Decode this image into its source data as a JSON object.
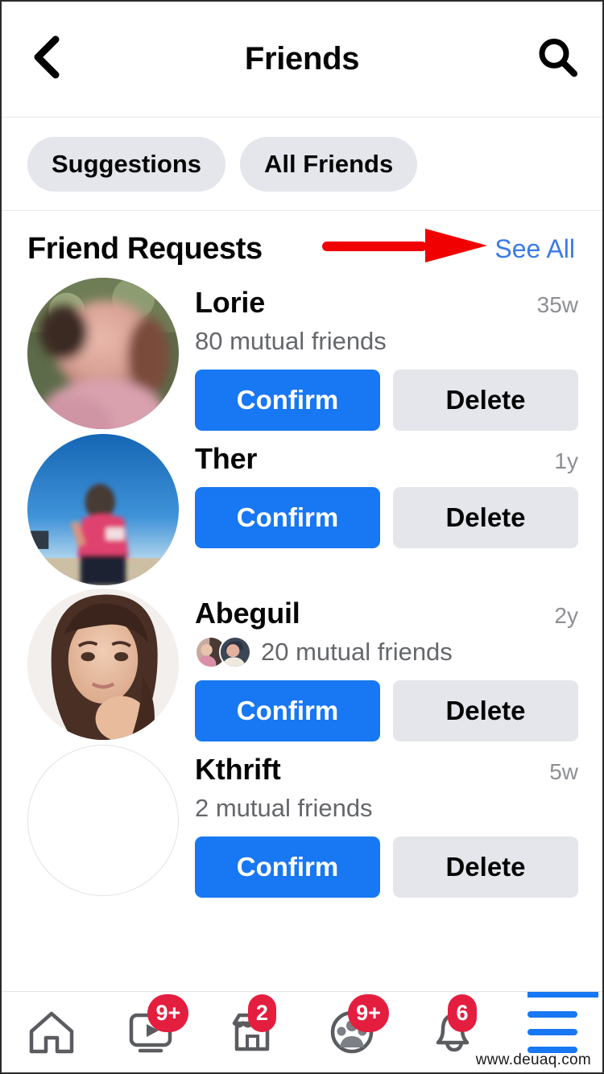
{
  "header": {
    "back_icon": "chevron-left-icon",
    "title": "Friends",
    "search_icon": "search-icon"
  },
  "chips": [
    {
      "label": "Suggestions"
    },
    {
      "label": "All Friends"
    }
  ],
  "section": {
    "title": "Friend Requests",
    "see_all_label": "See All",
    "annotation": {
      "type": "arrow",
      "color": "#f00000",
      "points_to": "See All"
    }
  },
  "requests": [
    {
      "name": "Lorie",
      "time": "35w",
      "mutual": "80 mutual friends",
      "mutual_faces": 0,
      "avatar": "blurred-photo-pink",
      "confirm_label": "Confirm",
      "delete_label": "Delete"
    },
    {
      "name": "Ther",
      "time": "1y",
      "mutual": "",
      "mutual_faces": 0,
      "avatar": "blurred-photo-beach",
      "confirm_label": "Confirm",
      "delete_label": "Delete"
    },
    {
      "name": "Abeguil",
      "time": "2y",
      "mutual": "20 mutual friends",
      "mutual_faces": 2,
      "avatar": "portrait-photo",
      "confirm_label": "Confirm",
      "delete_label": "Delete"
    },
    {
      "name": "Kthrift",
      "time": "5w",
      "mutual": "2 mutual friends",
      "mutual_faces": 0,
      "avatar": "empty-placeholder",
      "confirm_label": "Confirm",
      "delete_label": "Delete"
    }
  ],
  "bottom_nav": [
    {
      "icon": "home-icon",
      "badge": ""
    },
    {
      "icon": "video-icon",
      "badge": "9+"
    },
    {
      "icon": "marketplace-icon",
      "badge": "2"
    },
    {
      "icon": "groups-icon",
      "badge": "9+"
    },
    {
      "icon": "bell-icon",
      "badge": "6"
    },
    {
      "icon": "menu-icon",
      "badge": "",
      "active": true
    }
  ],
  "colors": {
    "primary_blue": "#1877f2",
    "link_blue": "#3b7ae8",
    "chip_gray": "#e4e6eb",
    "badge_red": "#e41e3f",
    "annotation_red": "#f00000",
    "secondary_text": "#65676b"
  },
  "watermark": "www.deuaq.com"
}
